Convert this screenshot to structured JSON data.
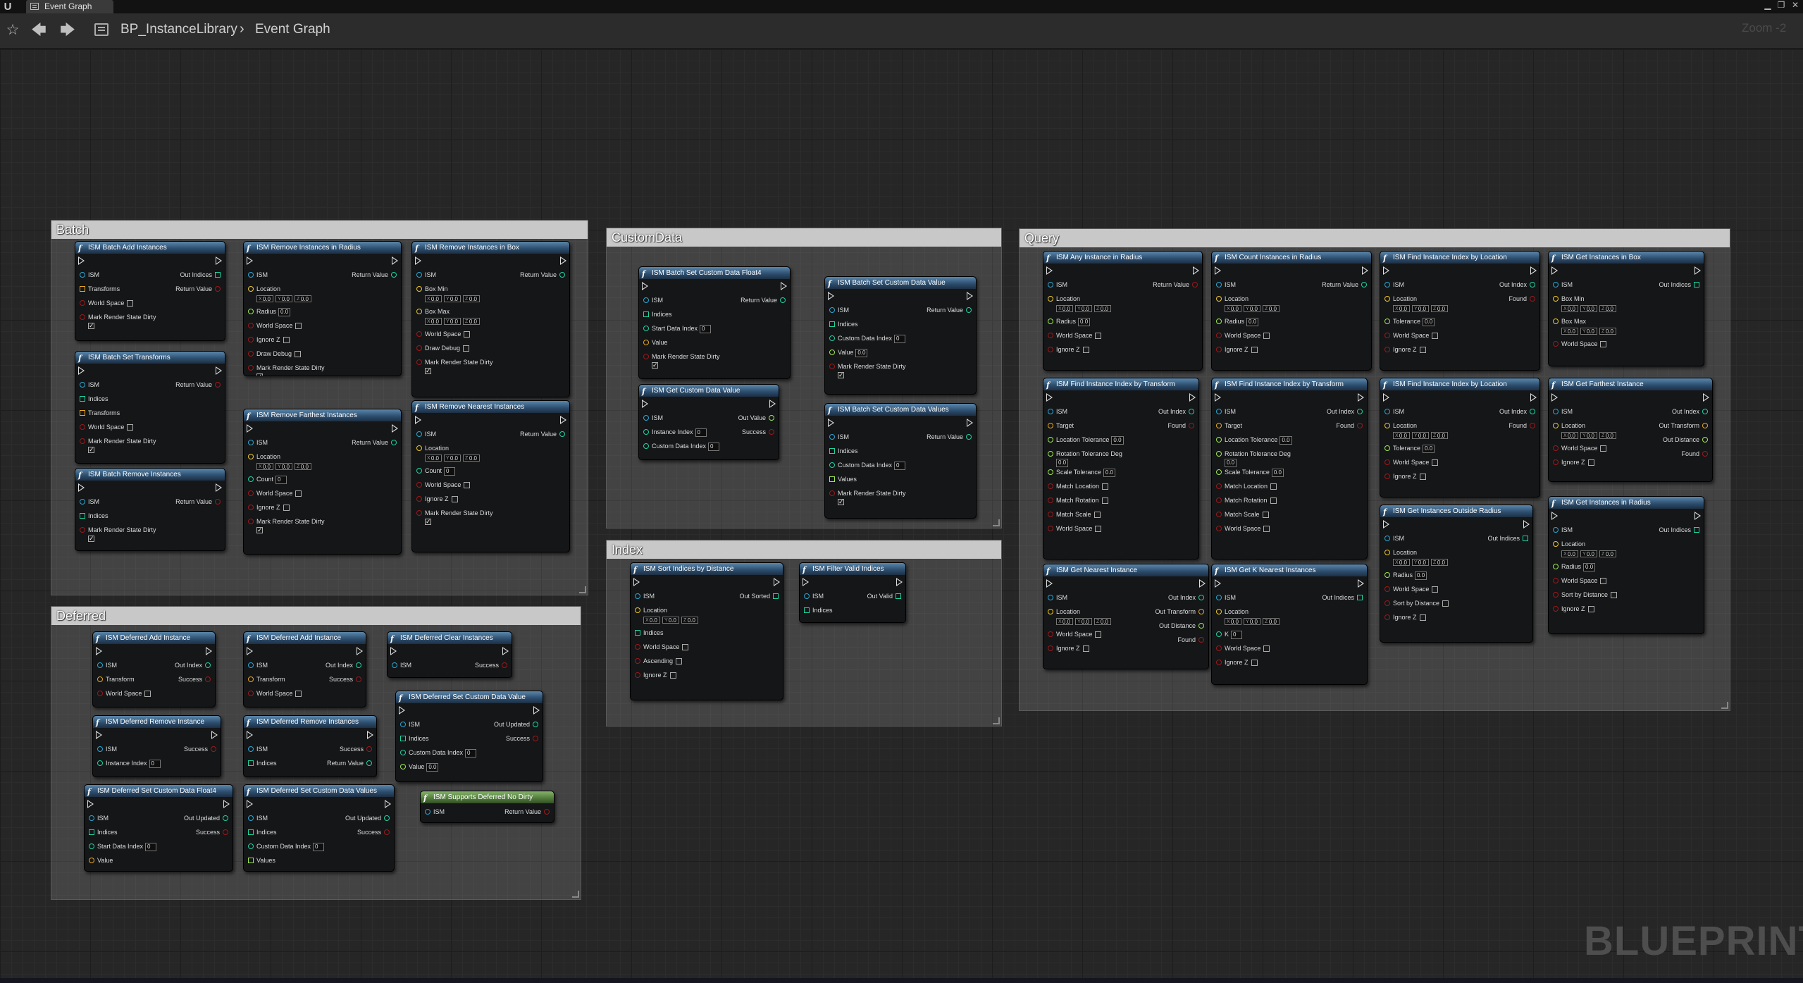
{
  "window": {
    "tab_title": "Event Graph",
    "minimize": "▁",
    "restore": "❐",
    "close": "✕"
  },
  "toolbar": {
    "breadcrumb_root": "BP_InstanceLibrary",
    "breadcrumb_sep": "›",
    "breadcrumb_current": "Event Graph",
    "zoom": "Zoom -2"
  },
  "watermark": "BLUEPRINT",
  "comments": {
    "batch": "Batch",
    "deferred": "Deferred",
    "customdata": "CustomData",
    "index": "Index",
    "query": "Query"
  },
  "pins": {
    "ism": "ISM",
    "return_value": "Return Value",
    "out_indices": "Out Indices",
    "transforms": "Transforms",
    "world_space": "World Space",
    "mark_dirty": "Mark Render State Dirty",
    "indices": "Indices",
    "location": "Location",
    "radius": "Radius",
    "ignore_z": "Ignore Z",
    "draw_debug": "Draw Debug",
    "box_min": "Box Min",
    "box_max": "Box Max",
    "count": "Count",
    "out_index": "Out Index",
    "transform": "Transform",
    "success": "Success",
    "instance_index": "Instance Index",
    "out_updated": "Out Updated",
    "custom_data_index": "Custom Data Index",
    "value": "Value",
    "start_data_index": "Start Data Index",
    "values": "Values",
    "out_value": "Out Value",
    "out_sorted": "Out Sorted",
    "ascending": "Ascending",
    "out_valid": "Out Valid",
    "found": "Found",
    "tolerance": "Tolerance",
    "target": "Target",
    "location_tolerance": "Location Tolerance",
    "rotation_tolerance_deg": "Rotation Tolerance Deg",
    "scale_tolerance": "Scale Tolerance",
    "match_location": "Match Location",
    "match_rotation": "Match Rotation",
    "match_scale": "Match Scale",
    "out_transform": "Out Transform",
    "out_distance": "Out Distance",
    "k": "K",
    "sort_by_distance": "Sort by Distance"
  },
  "vec_zero": "0.0",
  "int_zero": "0",
  "nodes": {
    "batch_add": "ISM Batch Add Instances",
    "remove_radius": "ISM Remove Instances in Radius",
    "remove_box": "ISM Remove Instances in Box",
    "batch_set_transforms": "ISM Batch Set Transforms",
    "remove_farthest": "ISM Remove Farthest Instances",
    "remove_nearest": "ISM Remove Nearest Instances",
    "batch_remove": "ISM Batch Remove Instances",
    "def_add1": "ISM Deferred Add Instance",
    "def_add2": "ISM Deferred Add Instance",
    "def_clear": "ISM Deferred Clear Instances",
    "def_remove1": "ISM Deferred Remove Instance",
    "def_remove2": "ISM Deferred Remove Instances",
    "def_set_cd": "ISM Deferred Set Custom Data Value",
    "def_set_f4": "ISM Deferred Set Custom Data Float4",
    "def_set_values": "ISM Deferred Set Custom Data Values",
    "supports_deferred": "ISM Supports Deferred No Dirty",
    "batch_set_f4": "ISM Batch Set Custom Data Float4",
    "batch_set_value": "ISM Batch Set Custom Data Value",
    "get_cd_value": "ISM Get Custom Data Value",
    "batch_set_values": "ISM Batch Set Custom Data Values",
    "sort_indices": "ISM Sort Indices by Distance",
    "filter_valid": "ISM Filter Valid Indices",
    "any_in_radius": "ISM Any Instance in Radius",
    "count_in_radius": "ISM Count Instances in Radius",
    "find_by_location1": "ISM Find Instance Index by Location",
    "get_in_box": "ISM Get Instances in Box",
    "find_by_transform1": "ISM Find Instance Index by Transform",
    "find_by_transform2": "ISM Find Instance Index by Transform",
    "find_by_location2": "ISM Find Instance Index by Location",
    "get_farthest": "ISM Get Farthest Instance",
    "get_outside_radius": "ISM Get Instances Outside Radius",
    "get_in_radius": "ISM Get Instances in Radius",
    "get_nearest": "ISM Get Nearest Instance",
    "get_k_nearest": "ISM Get K Nearest Instances"
  },
  "colors": {
    "exec": "#dddddd",
    "object": "#2aa7d6",
    "struct": "#e8a626",
    "vector": "#f0c828",
    "float": "#a0e854",
    "bool": "#a01818",
    "int": "#1ed4a0",
    "array_struct": "#e8a626",
    "array_int": "#1ed4a0"
  }
}
